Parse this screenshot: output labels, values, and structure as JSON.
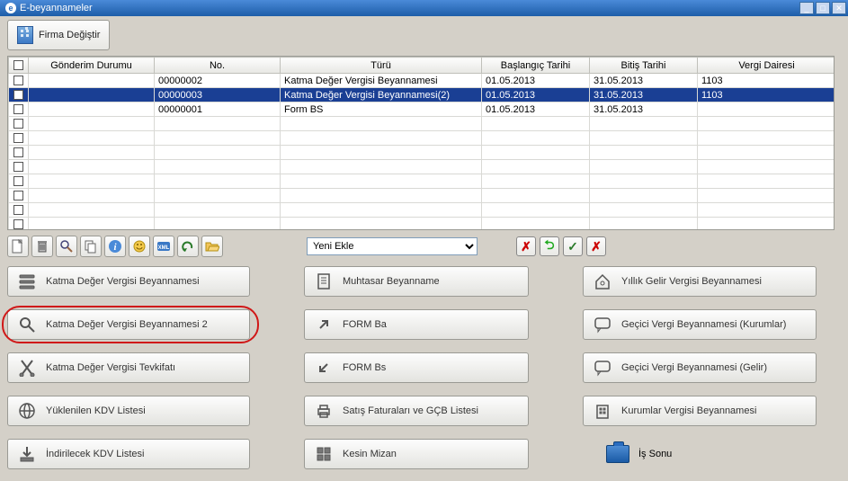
{
  "window": {
    "title": "E-beyannameler"
  },
  "topbar": {
    "firma_button": "Firma Değiştir"
  },
  "grid": {
    "headers": {
      "check": "",
      "gonderim": "Gönderim Durumu",
      "no": "No.",
      "turu": "Türü",
      "baslangic": "Başlangıç Tarihi",
      "bitis": "Bitiş Tarihi",
      "vergi": "Vergi Dairesi"
    },
    "rows": [
      {
        "no": "00000002",
        "turu": "Katma Değer Vergisi Beyannamesi",
        "baslangic": "01.05.2013",
        "bitis": "31.05.2013",
        "vergi": "1103",
        "sel": false
      },
      {
        "no": "00000003",
        "turu": "Katma Değer Vergisi Beyannamesi(2)",
        "baslangic": "01.05.2013",
        "bitis": "31.05.2013",
        "vergi": "1103",
        "sel": true
      },
      {
        "no": "00000001",
        "turu": "Form BS",
        "baslangic": "01.05.2013",
        "bitis": "31.05.2013",
        "vergi": "",
        "sel": false
      }
    ]
  },
  "combo": {
    "selected": "Yeni Ekle"
  },
  "modules": {
    "col1": [
      "Katma Değer Vergisi Beyannamesi",
      "Katma Değer Vergisi Beyannamesi 2",
      "Katma Değer Vergisi Tevkifatı",
      "Yüklenilen KDV Listesi",
      "İndirilecek KDV Listesi"
    ],
    "col2": [
      "Muhtasar Beyanname",
      "FORM Ba",
      "FORM Bs",
      "Satış Faturaları ve GÇB Listesi",
      "Kesin Mizan"
    ],
    "col3": [
      "Yıllık Gelir Vergisi Beyannamesi",
      "Geçici Vergi Beyannamesi (Kurumlar)",
      "Geçici Vergi Beyannamesi (Gelir)",
      "Kurumlar Vergisi Beyannamesi"
    ],
    "is_sonu": "İş Sonu"
  }
}
